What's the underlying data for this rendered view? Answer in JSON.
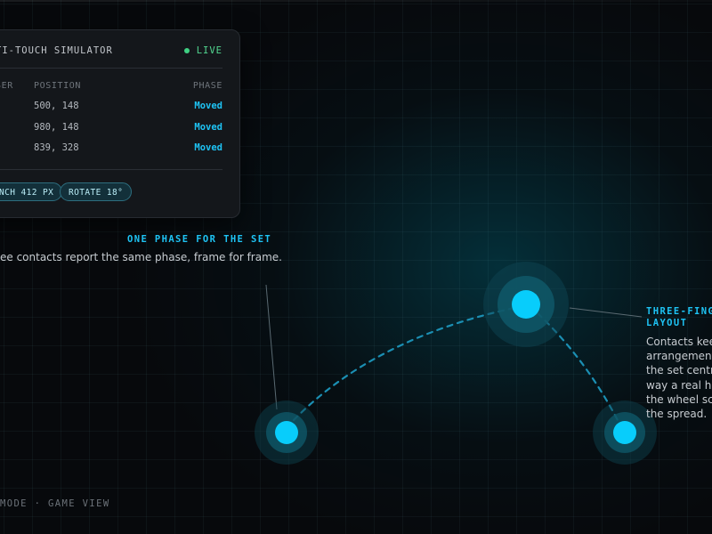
{
  "panel": {
    "title": "TI-TOUCH SIMULATOR",
    "status": "LIVE",
    "status_color": "#3fd183",
    "columns": [
      "SER",
      "POSITION",
      "PHASE"
    ],
    "rows": [
      {
        "position": "500, 148",
        "phase": "Moved"
      },
      {
        "position": "980, 148",
        "phase": "Moved"
      },
      {
        "position": "839, 328",
        "phase": "Moved"
      }
    ],
    "chips": [
      "NCH 412 PX",
      "ROTATE 18°"
    ]
  },
  "annotation_left": {
    "title": "ONE PHASE FOR THE SET",
    "text": "ee contacts report the same phase, frame for frame."
  },
  "annotation_right": {
    "title_lines": [
      "THREE-FING",
      "LAYOUT"
    ],
    "lines": [
      "Contacts kee",
      "arrangement",
      "the set centr",
      "way a real ha",
      "the wheel sc",
      "the spread."
    ]
  },
  "footer": {
    "text": "MODE · GAME VIEW"
  },
  "colors": {
    "accent": "#1ec3f4",
    "touch_point": "#08cdfb",
    "background": "#07090b"
  },
  "icons": {
    "status": "live-dot-icon",
    "touch": "touch-point-icon"
  }
}
